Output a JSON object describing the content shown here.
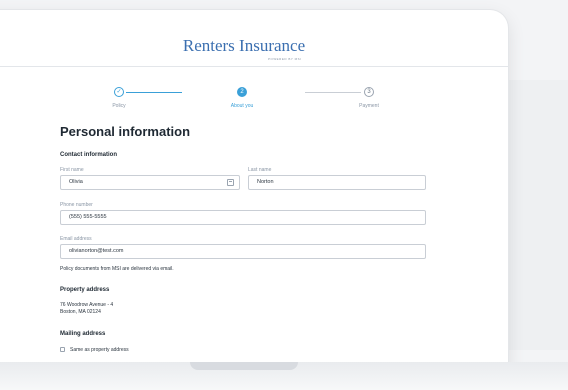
{
  "header": {
    "brand": "Renters Insurance",
    "brand_sub": "POWERED BY MSI"
  },
  "stepper": {
    "steps": [
      {
        "label": "Policy",
        "state": "complete",
        "marker": "✓"
      },
      {
        "label": "About you",
        "state": "active",
        "marker": "2"
      },
      {
        "label": "Payment",
        "state": "pending",
        "marker": "3"
      }
    ]
  },
  "page_title": "Personal information",
  "contact": {
    "title": "Contact information",
    "first_name_label": "First name",
    "first_name_value": "Olivia",
    "last_name_label": "Last name",
    "last_name_value": "Norton",
    "phone_label": "Phone number",
    "phone_value": "(555) 555-5555",
    "email_label": "Email address",
    "email_value": "olivianorton@test.com",
    "email_note": "Policy documents from MSI are delivered via email."
  },
  "property": {
    "title": "Property address",
    "line1": "76 Woodrow Avenue - 4",
    "line2": "Boston, MA 02124"
  },
  "mailing": {
    "title": "Mailing address",
    "checkbox_label": "Same as property address"
  },
  "colors": {
    "accent": "#3aa0d8",
    "brand": "#3b6fb0"
  }
}
